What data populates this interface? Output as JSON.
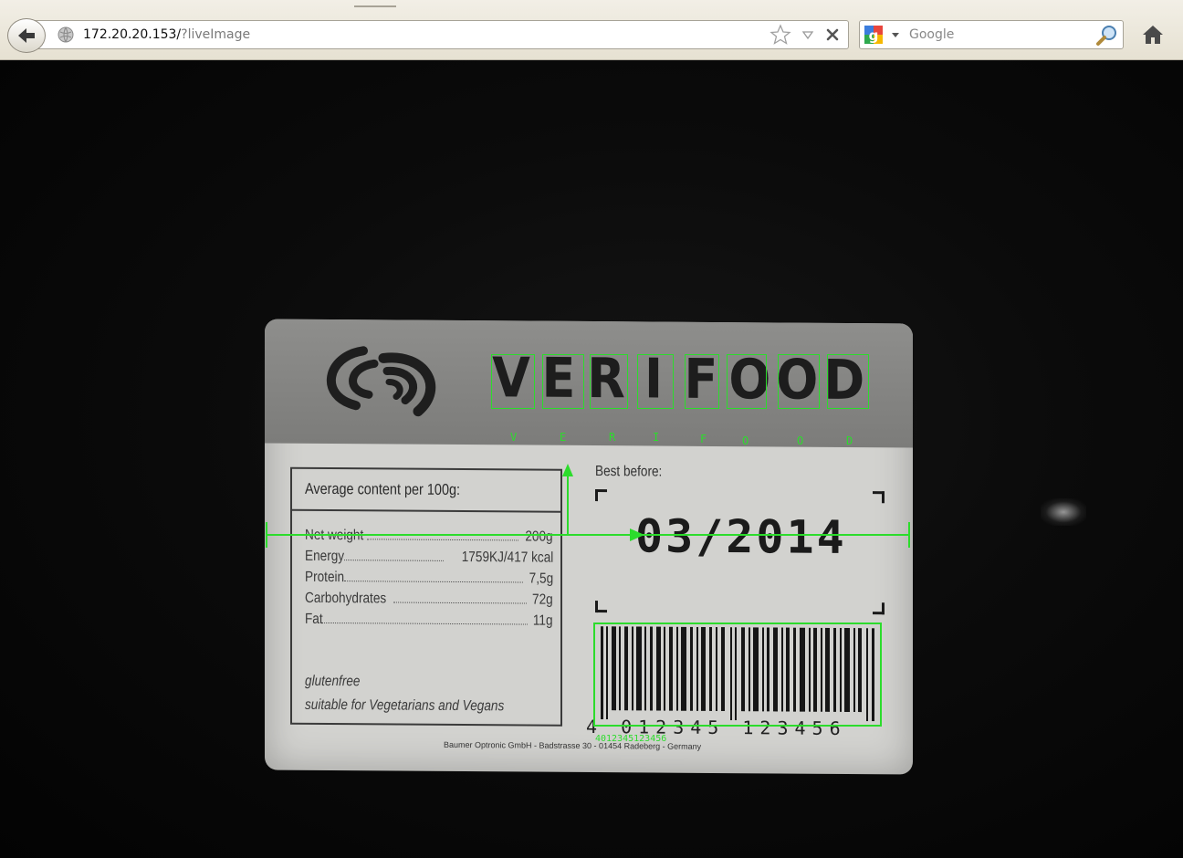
{
  "browser": {
    "url_host": "172.20.20.153/",
    "url_path": "?liveImage",
    "search_placeholder": "Google",
    "icons": [
      "back-arrow-icon",
      "globe-icon",
      "star-icon",
      "dropmarker-icon",
      "stop-icon",
      "google-icon",
      "search-icon",
      "home-icon"
    ]
  },
  "label": {
    "brand_letters": [
      "V",
      "E",
      "R",
      "I",
      "F",
      "O",
      "O",
      "D"
    ],
    "nutrition_header": "Average content per 100g:",
    "nutrition_rows": [
      {
        "name": "Net weight",
        "value": "200g"
      },
      {
        "name": "Energy",
        "value": "1759KJ/417 kcal"
      },
      {
        "name": "Protein",
        "value": "7,5g"
      },
      {
        "name": "Carbohydrates",
        "value": "72g"
      },
      {
        "name": "Fat",
        "value": "11g"
      }
    ],
    "notes": [
      "glutenfree",
      "suitable for Vegetarians and Vegans"
    ],
    "best_before_label": "Best before:",
    "date": "03/2014",
    "barcode_digits": "4 012345 123456",
    "footer": "Baumer Optronic GmbH - Badstrasse 30 - 01454 Radeberg - Germany"
  },
  "overlay": {
    "ocr_chars": [
      "V",
      "E",
      "R",
      "I",
      "F",
      "O",
      "O",
      "D"
    ],
    "barcode_result": "4012345123456",
    "color": "#2cdc2c"
  }
}
